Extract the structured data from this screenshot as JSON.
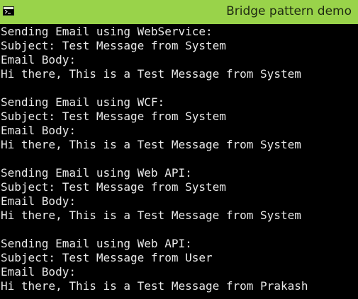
{
  "window": {
    "title": "Bridge pattern demo",
    "icon": "console-icon"
  },
  "console": {
    "lines": [
      "Sending Email using WebService:",
      "Subject: Test Message from System",
      "Email Body:",
      "Hi there, This is a Test Message from System",
      "",
      "Sending Email using WCF:",
      "Subject: Test Message from System",
      "Email Body:",
      "Hi there, This is a Test Message from System",
      "",
      "Sending Email using Web API:",
      "Subject: Test Message from System",
      "Email Body:",
      "Hi there, This is a Test Message from System",
      "",
      "Sending Email using Web API:",
      "Subject: Test Message from User",
      "Email Body:",
      "Hi there, This is a Test Message from Prakash"
    ]
  }
}
